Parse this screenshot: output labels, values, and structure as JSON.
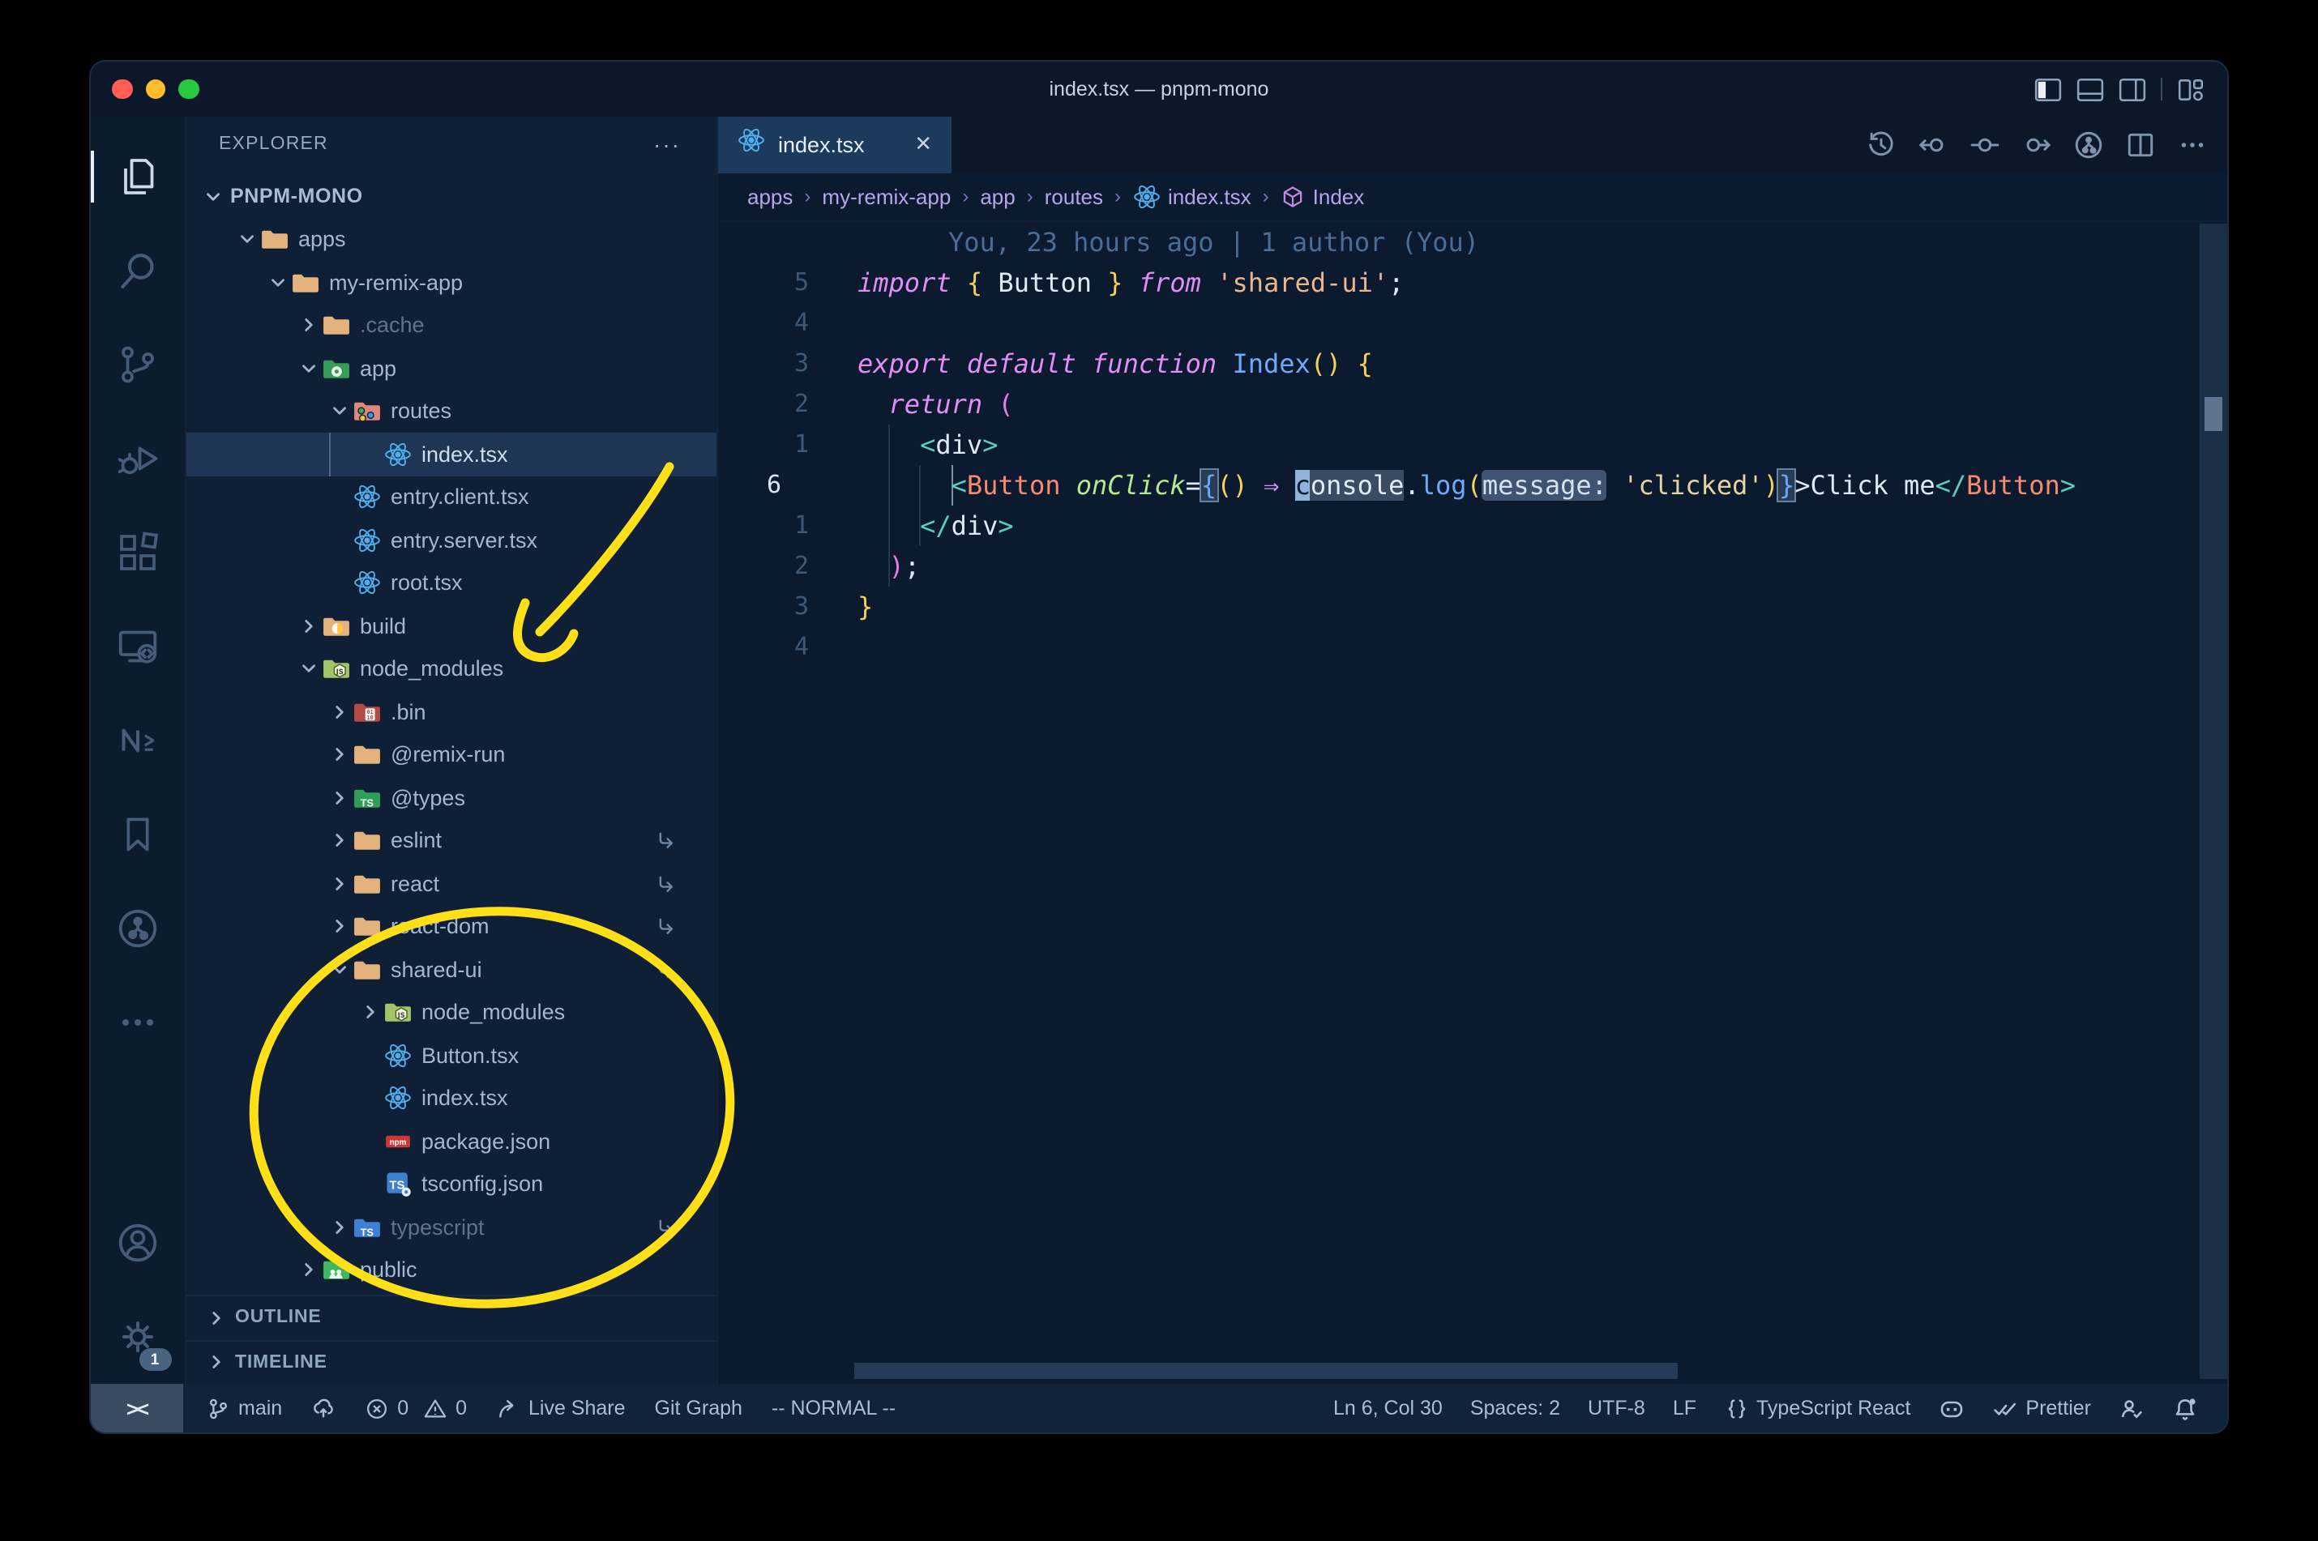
{
  "window": {
    "title": "index.tsx — pnpm-mono"
  },
  "titlebar": {
    "traffic_lights": [
      "close",
      "minimize",
      "zoom"
    ],
    "layout_icons": [
      "toggle-sidebar-left-icon",
      "toggle-panel-icon",
      "toggle-sidebar-right-icon",
      "separator",
      "customize-layout-icon"
    ]
  },
  "activity_bar": {
    "top": [
      {
        "name": "explorer",
        "icon": "files-icon",
        "active": true
      },
      {
        "name": "search",
        "icon": "search-icon"
      },
      {
        "name": "source-control",
        "icon": "source-control-icon"
      },
      {
        "name": "run-debug",
        "icon": "debug-icon"
      },
      {
        "name": "extensions",
        "icon": "extensions-icon"
      },
      {
        "name": "remote-explorer",
        "icon": "remote-explorer-icon"
      },
      {
        "name": "nx-console",
        "icon": "nx-icon"
      },
      {
        "name": "bookmarks",
        "icon": "bookmark-icon"
      },
      {
        "name": "git-graph",
        "icon": "git-graph-icon"
      },
      {
        "name": "more",
        "icon": "ellipsis-icon"
      }
    ],
    "bottom": [
      {
        "name": "accounts",
        "icon": "account-icon"
      },
      {
        "name": "settings",
        "icon": "gear-icon",
        "badge": "1"
      }
    ]
  },
  "explorer": {
    "header": "EXPLORER",
    "more_label": "···",
    "workspace": {
      "label": "PNPM-MONO",
      "chevron": "open"
    },
    "items": [
      {
        "label": "apps",
        "level": 1,
        "chev": "open",
        "icon": "folder-tan"
      },
      {
        "label": "my-remix-app",
        "level": 2,
        "chev": "open",
        "icon": "folder-tan"
      },
      {
        "label": ".cache",
        "level": 3,
        "chev": "closed",
        "icon": "folder-tan",
        "dim": true
      },
      {
        "label": "app",
        "level": 3,
        "chev": "open",
        "icon": "folder-app"
      },
      {
        "label": "routes",
        "level": 4,
        "chev": "open",
        "icon": "folder-routes"
      },
      {
        "label": "index.tsx",
        "level": 5,
        "chev": "none",
        "icon": "react-icon",
        "selected": true
      },
      {
        "label": "entry.client.tsx",
        "level": 4,
        "chev": "none",
        "icon": "react-icon"
      },
      {
        "label": "entry.server.tsx",
        "level": 4,
        "chev": "none",
        "icon": "react-icon"
      },
      {
        "label": "root.tsx",
        "level": 4,
        "chev": "none",
        "icon": "react-icon"
      },
      {
        "label": "build",
        "level": 3,
        "chev": "closed",
        "icon": "folder-build"
      },
      {
        "label": "node_modules",
        "level": 3,
        "chev": "open",
        "icon": "folder-node"
      },
      {
        "label": ".bin",
        "level": 4,
        "chev": "closed",
        "icon": "folder-bin"
      },
      {
        "label": "@remix-run",
        "level": 4,
        "chev": "closed",
        "icon": "folder-tan"
      },
      {
        "label": "@types",
        "level": 4,
        "chev": "closed",
        "icon": "folder-types"
      },
      {
        "label": "eslint",
        "level": 4,
        "chev": "closed",
        "icon": "folder-tan",
        "symlink": true
      },
      {
        "label": "react",
        "level": 4,
        "chev": "closed",
        "icon": "folder-tan",
        "symlink": true
      },
      {
        "label": "react-dom",
        "level": 4,
        "chev": "closed",
        "icon": "folder-tan",
        "symlink": true
      },
      {
        "label": "shared-ui",
        "level": 4,
        "chev": "open",
        "icon": "folder-tan",
        "symlink": true
      },
      {
        "label": "node_modules",
        "level": 5,
        "chev": "closed",
        "icon": "folder-node"
      },
      {
        "label": "Button.tsx",
        "level": 5,
        "chev": "none",
        "icon": "react-icon"
      },
      {
        "label": "index.tsx",
        "level": 5,
        "chev": "none",
        "icon": "react-icon"
      },
      {
        "label": "package.json",
        "level": 5,
        "chev": "none",
        "icon": "npm-icon"
      },
      {
        "label": "tsconfig.json",
        "level": 5,
        "chev": "none",
        "icon": "tsconfig-icon"
      },
      {
        "label": "typescript",
        "level": 4,
        "chev": "closed",
        "icon": "folder-ts",
        "dim": true,
        "symlink": true
      },
      {
        "label": "public",
        "level": 3,
        "chev": "closed",
        "icon": "folder-public"
      }
    ],
    "panels": [
      {
        "label": "OUTLINE"
      },
      {
        "label": "TIMELINE"
      }
    ]
  },
  "editor": {
    "tab": {
      "label": "index.tsx",
      "icon": "react-icon",
      "close": "✕"
    },
    "toolbar_icons": [
      "history-icon",
      "previous-change-icon",
      "change-icon",
      "next-change-icon",
      "git-graph-circle-icon",
      "split-editor-icon",
      "more-icon"
    ],
    "breadcrumbs": [
      {
        "label": "apps"
      },
      {
        "label": "my-remix-app"
      },
      {
        "label": "app"
      },
      {
        "label": "routes"
      },
      {
        "label": "index.tsx",
        "icon": "react-icon"
      },
      {
        "label": "Index",
        "icon": "symbol-module-icon"
      }
    ],
    "blame_annotation": "You, 23 hours ago | 1 author (You)",
    "code_lines": [
      {
        "gut": "",
        "blame": true,
        "tokens": [
          [
            "blame",
            "You, 23 hours ago | 1 author (You)"
          ]
        ]
      },
      {
        "gut": "5",
        "tokens": [
          [
            "kw",
            "import"
          ],
          [
            "pl",
            " "
          ],
          [
            "by",
            "{"
          ],
          [
            "pl",
            " Button "
          ],
          [
            "by",
            "}"
          ],
          [
            "pl",
            " "
          ],
          [
            "kw",
            "from"
          ],
          [
            "pl",
            " "
          ],
          [
            "str",
            "'shared-ui'"
          ],
          [
            "pl",
            ";"
          ]
        ]
      },
      {
        "gut": "4",
        "tokens": []
      },
      {
        "gut": "3",
        "tokens": [
          [
            "kw",
            "export"
          ],
          [
            "pl",
            " "
          ],
          [
            "kw",
            "default"
          ],
          [
            "pl",
            " "
          ],
          [
            "kw",
            "function"
          ],
          [
            "pl",
            " "
          ],
          [
            "fn",
            "Index"
          ],
          [
            "by",
            "()"
          ],
          [
            "pl",
            " "
          ],
          [
            "by",
            "{"
          ]
        ]
      },
      {
        "gut": "2",
        "tokens": [
          [
            "pl",
            "  "
          ],
          [
            "kw",
            "return"
          ],
          [
            "pl",
            " "
          ],
          [
            "bp",
            "("
          ]
        ]
      },
      {
        "gut": "1",
        "tokens": [
          [
            "pl",
            "    "
          ],
          [
            "tag",
            "<"
          ],
          [
            "pl",
            "div"
          ],
          [
            "tag",
            ">"
          ]
        ]
      },
      {
        "gut": "6",
        "current": true,
        "tokens": [
          [
            "pl",
            "      "
          ],
          [
            "tag",
            "<"
          ],
          [
            "cmp",
            "Button"
          ],
          [
            "pl",
            " "
          ],
          [
            "attr",
            "onClick"
          ],
          [
            "pl",
            "="
          ],
          [
            "bb",
            "{"
          ],
          [
            "by",
            "()"
          ],
          [
            "pl",
            " "
          ],
          [
            "arrow",
            "⇒"
          ],
          [
            "pl",
            " "
          ],
          [
            "cursor",
            "c"
          ],
          [
            "hl",
            "onsole"
          ],
          [
            "pl",
            "."
          ],
          [
            "fn",
            "log"
          ],
          [
            "by",
            "("
          ],
          [
            "hint",
            "message:"
          ],
          [
            "pl",
            " "
          ],
          [
            "str2",
            "'clicked'"
          ],
          [
            "by",
            ")"
          ],
          [
            "bb",
            "}"
          ],
          [
            "pl",
            ">Click me"
          ],
          [
            "tag",
            "</"
          ],
          [
            "cmp",
            "Button"
          ],
          [
            "tag",
            ">"
          ]
        ]
      },
      {
        "gut": "1",
        "tokens": [
          [
            "pl",
            "    "
          ],
          [
            "tag",
            "</"
          ],
          [
            "pl",
            "div"
          ],
          [
            "tag",
            ">"
          ]
        ]
      },
      {
        "gut": "2",
        "tokens": [
          [
            "pl",
            "  "
          ],
          [
            "bp",
            ")"
          ],
          [
            "pl",
            ";"
          ]
        ]
      },
      {
        "gut": "3",
        "tokens": [
          [
            "by",
            "}"
          ]
        ]
      },
      {
        "gut": "4",
        "tokens": []
      }
    ]
  },
  "status_bar": {
    "remote": {
      "label": "><"
    },
    "left_items": [
      {
        "icon": "git-branch-icon",
        "label": "main"
      },
      {
        "icon": "sync-icon",
        "label": ""
      },
      {
        "icon": "error-icon",
        "label": "0",
        "icon2": "warning-icon",
        "label2": "0"
      },
      {
        "icon": "live-share-icon",
        "label": "Live Share"
      },
      {
        "label": "Git Graph"
      },
      {
        "label": "-- NORMAL --"
      }
    ],
    "right_items": [
      {
        "label": "Ln 6, Col 30"
      },
      {
        "label": "Spaces: 2"
      },
      {
        "label": "UTF-8"
      },
      {
        "label": "LF"
      },
      {
        "icon": "braces-icon",
        "label": "TypeScript React"
      },
      {
        "icon": "copilot-icon"
      },
      {
        "icon": "double-check-icon",
        "label": "Prettier"
      },
      {
        "icon": "feedback-icon"
      },
      {
        "icon": "bell-dot-icon"
      }
    ]
  },
  "annotations": {
    "arrow": "hand-drawn yellow arrow pointing to node_modules",
    "ellipse": "hand-drawn yellow circle around shared-ui package contents"
  },
  "palette": {
    "annotation_yellow": "#ffe018",
    "selection_row": "#1e3553",
    "active_tab": "#1c3a5c",
    "editor_bg": "#0b1a2e",
    "sidebar_bg": "#0f1f35",
    "titlebar_bg": "#0c1829",
    "statusbar_bg": "#112339",
    "react_blue": "#4fb0f0",
    "breadcrumb_lavender": "#b7a5ec"
  }
}
